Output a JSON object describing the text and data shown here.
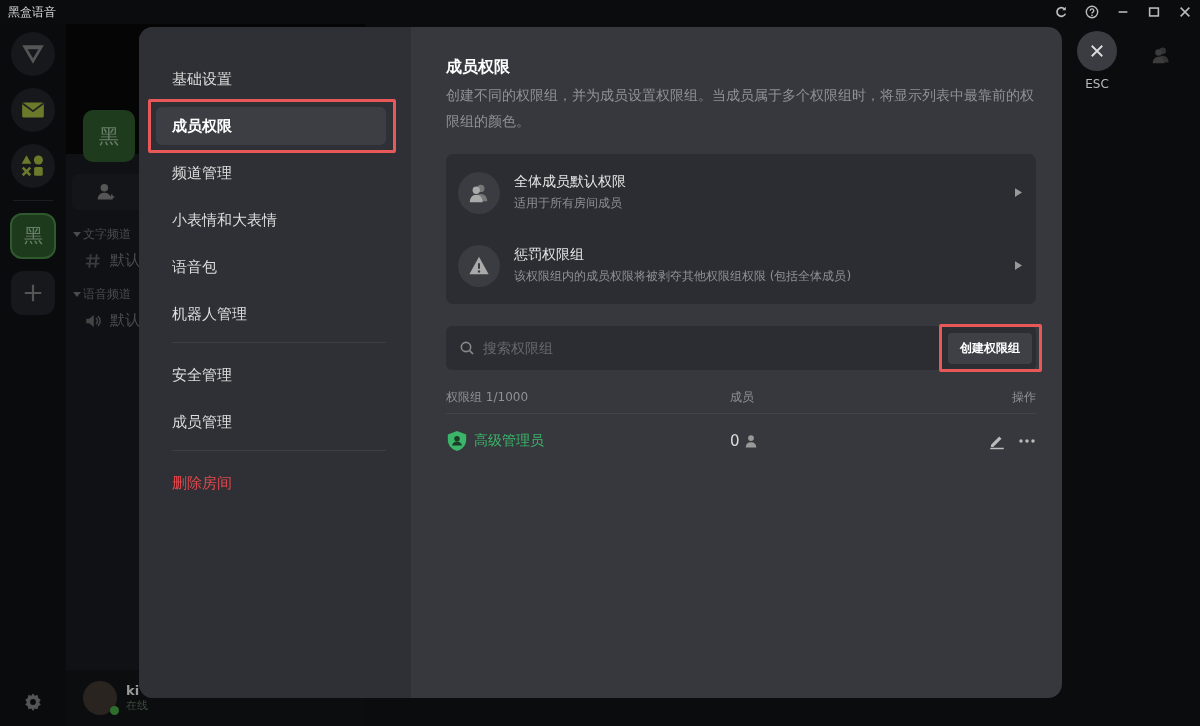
{
  "title_bar": {
    "title": "黑盒语音"
  },
  "rail": {
    "server": {
      "label": "黑",
      "selected": true
    }
  },
  "channel_panel": {
    "server_banner": "黑",
    "sections": [
      {
        "title": "文字频道",
        "expanded": true,
        "channels": [
          {
            "kind": "text",
            "name": "默认"
          }
        ]
      },
      {
        "title": "语音频道",
        "expanded": true,
        "channels": [
          {
            "kind": "voice",
            "name": "默认"
          }
        ]
      }
    ],
    "user": {
      "name": "ki",
      "status": "在线",
      "online": true
    }
  },
  "modal": {
    "nav": {
      "groups": [
        {
          "items": [
            {
              "label": "基础设置",
              "selected": false,
              "highlighted": false,
              "kind": "normal"
            },
            {
              "label": "成员权限",
              "selected": true,
              "highlighted": true,
              "kind": "normal"
            },
            {
              "label": "频道管理",
              "selected": false,
              "highlighted": false,
              "kind": "normal"
            },
            {
              "label": "小表情和大表情",
              "selected": false,
              "highlighted": false,
              "kind": "normal"
            },
            {
              "label": "语音包",
              "selected": false,
              "highlighted": false,
              "kind": "normal"
            },
            {
              "label": "机器人管理",
              "selected": false,
              "highlighted": false,
              "kind": "normal"
            }
          ]
        },
        {
          "items": [
            {
              "label": "安全管理",
              "selected": false,
              "highlighted": false,
              "kind": "normal"
            },
            {
              "label": "成员管理",
              "selected": false,
              "highlighted": false,
              "kind": "normal"
            }
          ]
        },
        {
          "items": [
            {
              "label": "删除房间",
              "selected": false,
              "highlighted": false,
              "kind": "danger"
            }
          ]
        }
      ]
    },
    "content": {
      "title": "成员权限",
      "description": "创建不同的权限组，并为成员设置权限组。当成员属于多个权限组时，将显示列表中最靠前的权限组的颜色。",
      "special_groups": [
        {
          "kind": "everyone",
          "title": "全体成员默认权限",
          "subtitle": "适用于所有房间成员"
        },
        {
          "kind": "penalty",
          "title": "惩罚权限组",
          "subtitle": "该权限组内的成员权限将被剥夺其他权限组权限 (包括全体成员)"
        }
      ],
      "search": {
        "placeholder": "搜索权限组"
      },
      "create_button": {
        "label": "创建权限组",
        "highlighted": true
      },
      "table": {
        "columns": [
          "权限组 1/1000",
          "成员",
          "操作"
        ],
        "rows": [
          {
            "name": "高级管理员",
            "color": "#3bb56a",
            "members": "0"
          }
        ]
      }
    }
  },
  "close_button": {
    "label": "ESC"
  }
}
